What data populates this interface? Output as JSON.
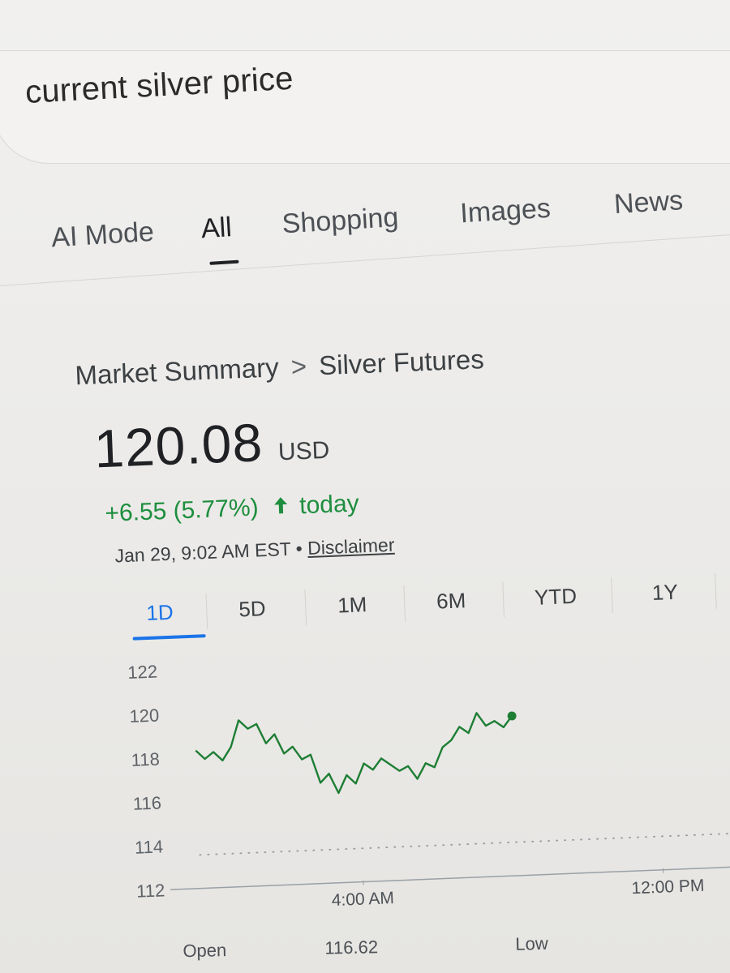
{
  "search": {
    "query": "current silver price"
  },
  "tabs": [
    {
      "label": "AI Mode",
      "active": false
    },
    {
      "label": "All",
      "active": true
    },
    {
      "label": "Shopping",
      "active": false
    },
    {
      "label": "Images",
      "active": false
    },
    {
      "label": "News",
      "active": false
    }
  ],
  "market": {
    "breadcrumb_root": "Market Summary",
    "breadcrumb_sep": ">",
    "breadcrumb_item": "Silver Futures",
    "price": "120.08",
    "currency": "USD",
    "change": "+6.55 (5.77%)",
    "change_icon": "arrow-up-icon",
    "change_period": "today",
    "timestamp": "Jan 29, 9:02 AM EST",
    "meta_sep": "•",
    "disclaimer": "Disclaimer"
  },
  "ranges": [
    {
      "label": "1D",
      "active": true
    },
    {
      "label": "5D",
      "active": false
    },
    {
      "label": "1M",
      "active": false
    },
    {
      "label": "6M",
      "active": false
    },
    {
      "label": "YTD",
      "active": false
    },
    {
      "label": "1Y",
      "active": false
    }
  ],
  "chart_data": {
    "type": "line",
    "series": [
      {
        "color": "#1e7e34",
        "x": [
          "0:00",
          "0:15",
          "0:30",
          "0:45",
          "1:00",
          "1:15",
          "1:30",
          "1:45",
          "2:00",
          "2:15",
          "2:30",
          "2:45",
          "3:00",
          "3:15",
          "3:30",
          "3:45",
          "4:00",
          "4:15",
          "4:30",
          "4:45",
          "5:00",
          "5:15",
          "5:30",
          "5:45",
          "6:00",
          "6:15",
          "6:30",
          "6:45",
          "7:00",
          "7:15",
          "7:30",
          "7:45",
          "8:00",
          "8:15",
          "8:30",
          "8:45",
          "9:00"
        ],
        "values": [
          118.3,
          117.9,
          118.2,
          117.8,
          118.4,
          119.6,
          119.2,
          119.4,
          118.5,
          118.9,
          118.0,
          118.3,
          117.7,
          117.9,
          116.6,
          117.0,
          116.1,
          116.9,
          116.5,
          117.4,
          117.1,
          117.6,
          117.3,
          117.0,
          117.2,
          116.6,
          117.3,
          117.1,
          118.0,
          118.3,
          118.9,
          118.6,
          119.5,
          118.9,
          119.1,
          118.8,
          119.3
        ]
      }
    ],
    "ylim": [
      112,
      122
    ],
    "yticks": [
      112,
      114,
      116,
      118,
      120,
      122
    ],
    "xticks": [
      "4:00 AM",
      "12:00 PM"
    ],
    "baseline": 113.53,
    "grid": false
  },
  "stats": [
    {
      "label": "Open"
    },
    {
      "value": "116.62"
    },
    {
      "label": "Low"
    }
  ],
  "colors": {
    "accent": "#1a73e8",
    "positive": "#1e8e3e",
    "line": "#1e7e34"
  }
}
